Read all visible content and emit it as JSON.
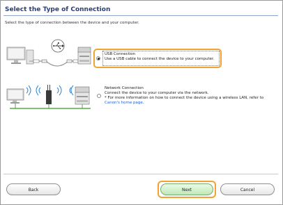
{
  "header": {
    "title": "Select the Type of Connection",
    "subtitle": "Select the type of connection between the device and your computer."
  },
  "options": [
    {
      "title": "USB Connection",
      "description": "Use a USB cable to connect the device to your computer.",
      "selected": true
    },
    {
      "title": "Network Connection",
      "description": "Connect the device to your computer via the network.",
      "note_prefix": "* For more information on how to connect the device using a wireless LAN, refer to",
      "link_text": "Canon's home page",
      "link_suffix": ".",
      "selected": false
    }
  ],
  "buttons": {
    "back": "Back",
    "next": "Next",
    "cancel": "Cancel"
  },
  "colors": {
    "highlight": "#f0a330",
    "title": "#2a3f7a",
    "link": "#1b5fd6"
  }
}
